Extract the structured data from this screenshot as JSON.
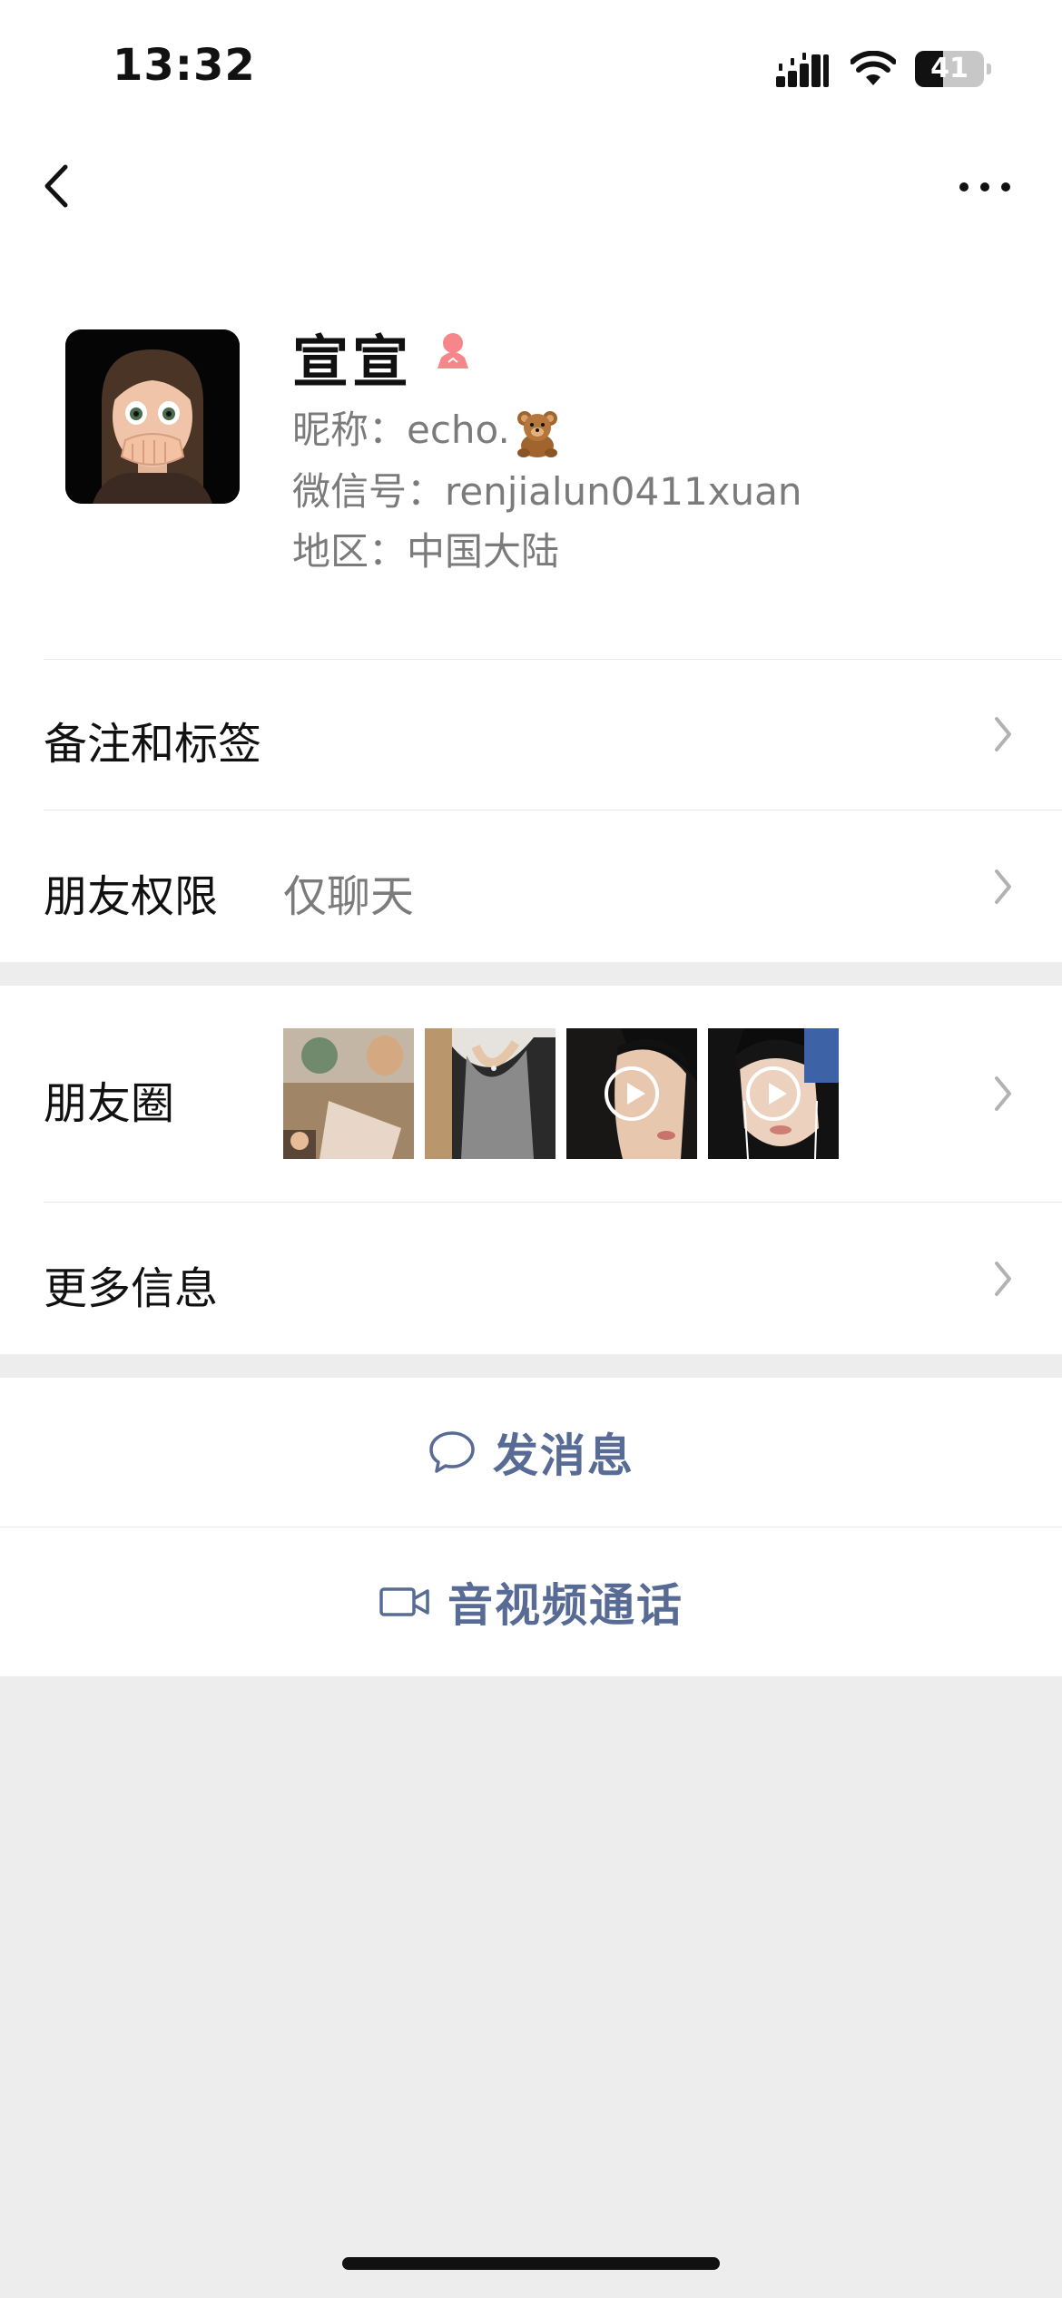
{
  "status_bar": {
    "time": "13:32",
    "battery": "41",
    "battery_level": 0.41
  },
  "nav": {
    "back_icon": "chevron-left-icon",
    "more_icon": "ellipsis-icon"
  },
  "profile": {
    "name": "宣宣",
    "gender_icon": "female-icon",
    "nickname": "昵称：echo.",
    "nickname_emoji": "teddy-bear-icon",
    "wechat_id": "微信号：renjialun0411xuan",
    "region": "地区：中国大陆"
  },
  "rows": {
    "remarks_label": "备注和标签",
    "permission_label": "朋友权限",
    "permission_value": "仅聊天",
    "moments_label": "朋友圈",
    "more_info_label": "更多信息"
  },
  "moments_thumbs": [
    {
      "kind": "photo",
      "has_play": false
    },
    {
      "kind": "photo",
      "has_play": false
    },
    {
      "kind": "video",
      "has_play": true
    },
    {
      "kind": "video",
      "has_play": true
    }
  ],
  "actions": {
    "message_label": "发消息",
    "message_icon": "chat-bubble-icon",
    "call_label": "音视频通话",
    "call_icon": "video-camera-icon"
  },
  "colors": {
    "link_blue": "#576b95",
    "background_gray": "#ededed",
    "female_pink": "#f7868a"
  }
}
